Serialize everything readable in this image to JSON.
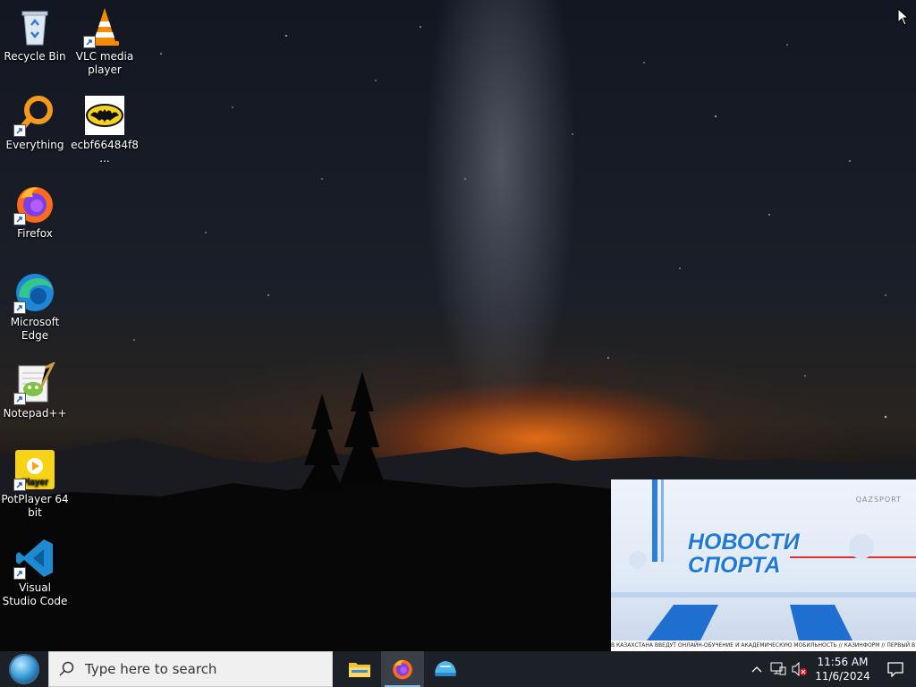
{
  "desktop_icons": [
    {
      "label": "Recycle Bin",
      "icon": "recycle-bin-icon",
      "shortcut": false
    },
    {
      "label": "VLC media player",
      "icon": "vlc-icon",
      "shortcut": true
    },
    {
      "label": "Everything",
      "icon": "everything-search-icon",
      "shortcut": true
    },
    {
      "label": "ecbf66484f8...",
      "icon": "batman-image-icon",
      "shortcut": false
    },
    {
      "label": "Firefox",
      "icon": "firefox-icon",
      "shortcut": true
    },
    {
      "label": "Microsoft Edge",
      "icon": "edge-icon",
      "shortcut": true
    },
    {
      "label": "Notepad++",
      "icon": "notepadpp-icon",
      "shortcut": true
    },
    {
      "label": "PotPlayer 64 bit",
      "icon": "potplayer-icon",
      "shortcut": true
    },
    {
      "label": "Visual Studio Code",
      "icon": "vscode-icon",
      "shortcut": true
    }
  ],
  "video_overlay": {
    "title_line1": "НОВОСТИ",
    "title_line2": "СПОРТА",
    "logo": "QAZSPORT",
    "ticker": "В КАЗАХСТАНА ВВЕДУТ ОНЛАЙН-ОБУЧЕНИЕ И АКАДЕМИЧЕСКУЮ МОБИЛЬНОСТЬ // КАЗИНФОРМ // ПЕРВЫЙ В КАЗ"
  },
  "taskbar": {
    "search_placeholder": "Type here to search",
    "apps": [
      {
        "name": "file-explorer",
        "icon": "folder-icon",
        "active": false
      },
      {
        "name": "firefox",
        "icon": "firefox-icon",
        "active": true
      },
      {
        "name": "app-blue",
        "icon": "blue-app-icon",
        "active": false
      }
    ],
    "tray": {
      "time": "11:56 AM",
      "date": "11/6/2024"
    }
  }
}
